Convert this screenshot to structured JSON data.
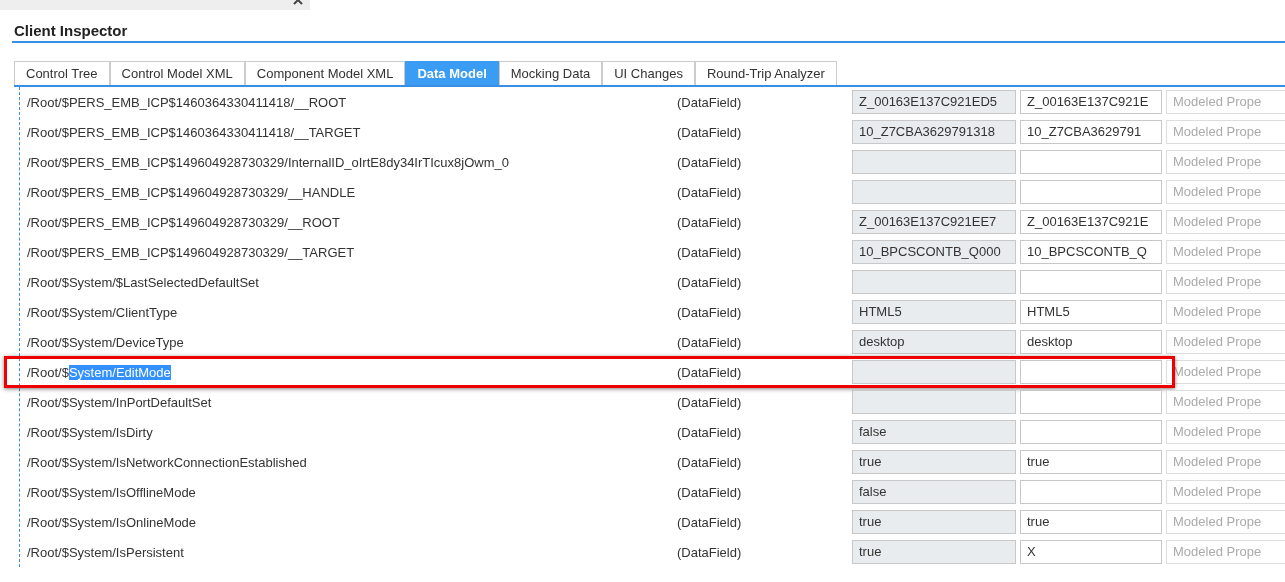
{
  "window": {
    "title": "Client Inspector"
  },
  "tabs": [
    {
      "label": "Control Tree",
      "selected": false
    },
    {
      "label": "Control Model XML",
      "selected": false
    },
    {
      "label": "Component Model XML",
      "selected": false
    },
    {
      "label": "Data Model",
      "selected": true
    },
    {
      "label": "Mocking Data",
      "selected": false
    },
    {
      "label": "UI Changes",
      "selected": false
    },
    {
      "label": "Round-Trip Analyzer",
      "selected": false
    }
  ],
  "rows": [
    {
      "path": "/Root/$PERS_EMB_ICP$1460364330411418/__ROOT",
      "type": "(DataField)",
      "current_value": "Z_00163E137C921ED5",
      "new_value": "Z_00163E137C921E",
      "placeholder": "Modeled Prope",
      "highlighted": false
    },
    {
      "path": "/Root/$PERS_EMB_ICP$1460364330411418/__TARGET",
      "type": "(DataField)",
      "current_value": "10_Z7CBA3629791318",
      "new_value": "10_Z7CBA3629791",
      "placeholder": "Modeled Prope",
      "highlighted": false
    },
    {
      "path": "/Root/$PERS_EMB_ICP$149604928730329/InternalID_oIrtE8dy34IrTIcux8jOwm_0",
      "type": "(DataField)",
      "placeholder": "Modeled Prope",
      "highlighted": false
    },
    {
      "path": "/Root/$PERS_EMB_ICP$149604928730329/__HANDLE",
      "type": "(DataField)",
      "placeholder": "Modeled Prope",
      "highlighted": false
    },
    {
      "path": "/Root/$PERS_EMB_ICP$149604928730329/__ROOT",
      "type": "(DataField)",
      "current_value": "Z_00163E137C921EE7",
      "new_value": "Z_00163E137C921E",
      "placeholder": "Modeled Prope",
      "highlighted": false
    },
    {
      "path": "/Root/$PERS_EMB_ICP$149604928730329/__TARGET",
      "type": "(DataField)",
      "current_value": "10_BPCSCONTB_Q000",
      "new_value": "10_BPCSCONTB_Q",
      "placeholder": "Modeled Prope",
      "highlighted": false
    },
    {
      "path": "/Root/$System/$LastSelectedDefaultSet",
      "type": "(DataField)",
      "placeholder": "Modeled Prope",
      "highlighted": false
    },
    {
      "path": "/Root/$System/ClientType",
      "type": "(DataField)",
      "current_value": "HTML5",
      "new_value": "HTML5",
      "placeholder": "Modeled Prope",
      "highlighted": false
    },
    {
      "path": "/Root/$System/DeviceType",
      "type": "(DataField)",
      "current_value": "desktop",
      "new_value": "desktop",
      "placeholder": "Modeled Prope",
      "highlighted": false
    },
    {
      "path": "/Root/$",
      "selected_text": "System/EditMode",
      "type": "(DataField)",
      "placeholder": "Modeled Prope",
      "highlighted": true
    },
    {
      "path": "/Root/$System/InPortDefaultSet",
      "type": "(DataField)",
      "placeholder": "Modeled Prope",
      "highlighted": false
    },
    {
      "path": "/Root/$System/IsDirty",
      "type": "(DataField)",
      "current_value": "false",
      "placeholder": "Modeled Prope",
      "highlighted": false
    },
    {
      "path": "/Root/$System/IsNetworkConnectionEstablished",
      "type": "(DataField)",
      "current_value": "true",
      "new_value": "true",
      "placeholder": "Modeled Prope",
      "highlighted": false
    },
    {
      "path": "/Root/$System/IsOfflineMode",
      "type": "(DataField)",
      "current_value": "false",
      "placeholder": "Modeled Prope",
      "highlighted": false
    },
    {
      "path": "/Root/$System/IsOnlineMode",
      "type": "(DataField)",
      "current_value": "true",
      "new_value": "true",
      "placeholder": "Modeled Prope",
      "highlighted": false
    },
    {
      "path": "/Root/$System/IsPersistent",
      "type": "(DataField)",
      "current_value": "true",
      "new_value": "X",
      "placeholder": "Modeled Prope",
      "highlighted": false
    }
  ]
}
